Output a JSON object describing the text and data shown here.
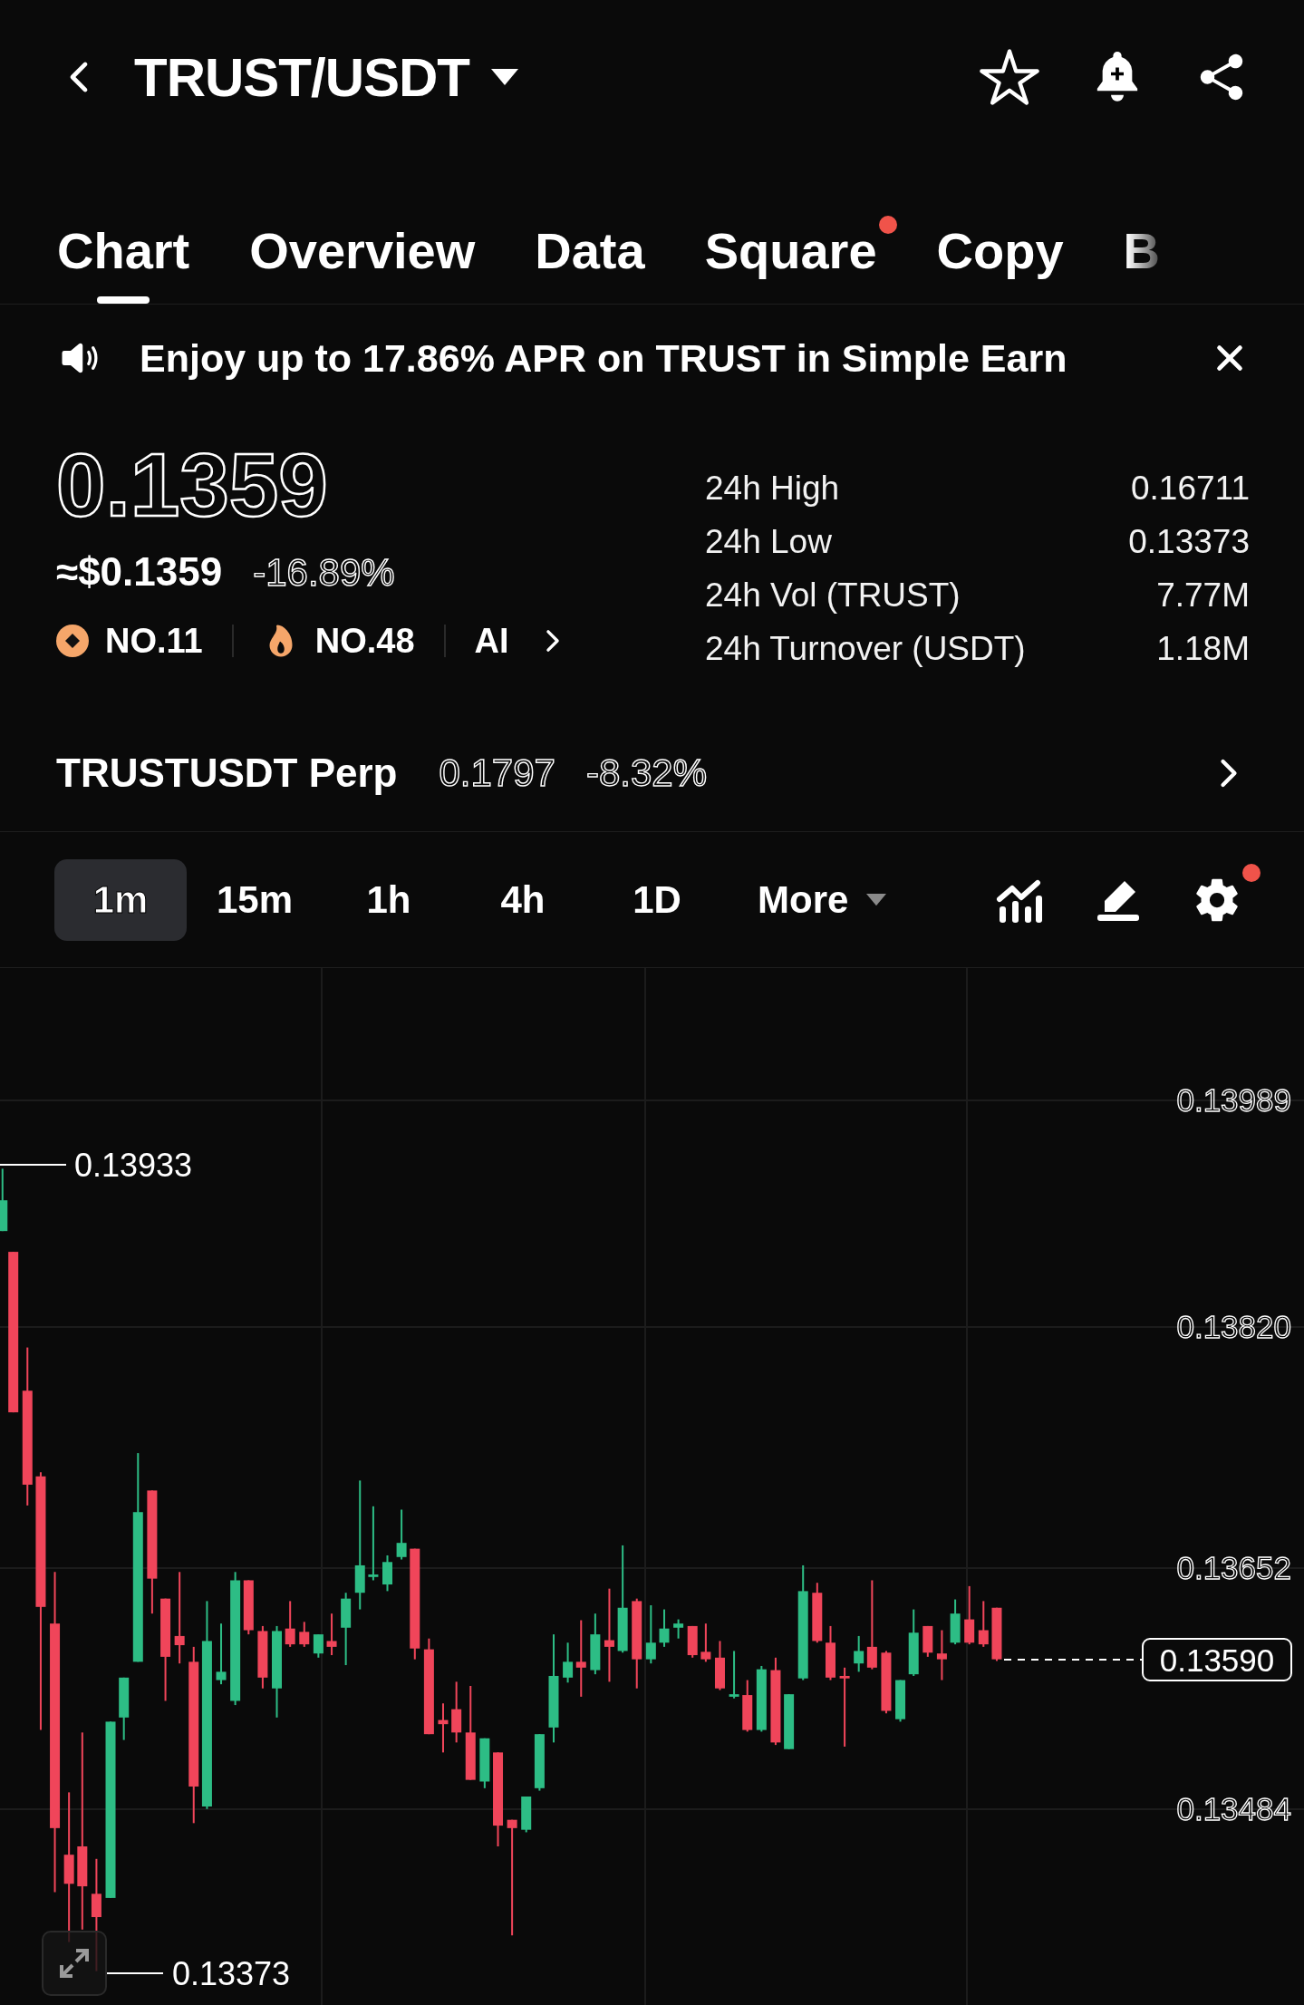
{
  "header": {
    "title": "TRUST/USDT"
  },
  "tabs": [
    {
      "label": "Chart",
      "selected": true,
      "dot": false
    },
    {
      "label": "Overview",
      "selected": false,
      "dot": false
    },
    {
      "label": "Data",
      "selected": false,
      "dot": false
    },
    {
      "label": "Square",
      "selected": false,
      "dot": true
    },
    {
      "label": "Copy",
      "selected": false,
      "dot": false
    },
    {
      "label": "B",
      "selected": false,
      "dot": false
    }
  ],
  "banner": {
    "text": "Enjoy up to 17.86% APR on TRUST in Simple Earn"
  },
  "price": {
    "last": "0.1359",
    "usd": "≈$0.1359",
    "change": "-16.89%"
  },
  "ranks": [
    {
      "kind": "coin",
      "label": "NO.11"
    },
    {
      "kind": "hot",
      "label": "NO.48"
    },
    {
      "kind": "ai",
      "label": "AI"
    }
  ],
  "stats": [
    {
      "label": "24h High",
      "value": "0.16711"
    },
    {
      "label": "24h Low",
      "value": "0.13373"
    },
    {
      "label": "24h Vol (TRUST)",
      "value": "7.77M"
    },
    {
      "label": "24h Turnover (USDT)",
      "value": "1.18M"
    }
  ],
  "perp": {
    "name": "TRUSTUSDT Perp",
    "price": "0.1797",
    "change": "-8.32%"
  },
  "timeframes": [
    {
      "label": "1m",
      "selected": true
    },
    {
      "label": "15m",
      "selected": false
    },
    {
      "label": "1h",
      "selected": false
    },
    {
      "label": "4h",
      "selected": false
    },
    {
      "label": "1D",
      "selected": false
    }
  ],
  "more": "More",
  "settings_dot": true,
  "chart": {
    "y_labels": [
      "0.13989",
      "0.13820",
      "0.13652",
      "0.13484"
    ],
    "high_marker": "0.13933",
    "low_marker": "0.13373",
    "last_price": "0.13590"
  }
}
